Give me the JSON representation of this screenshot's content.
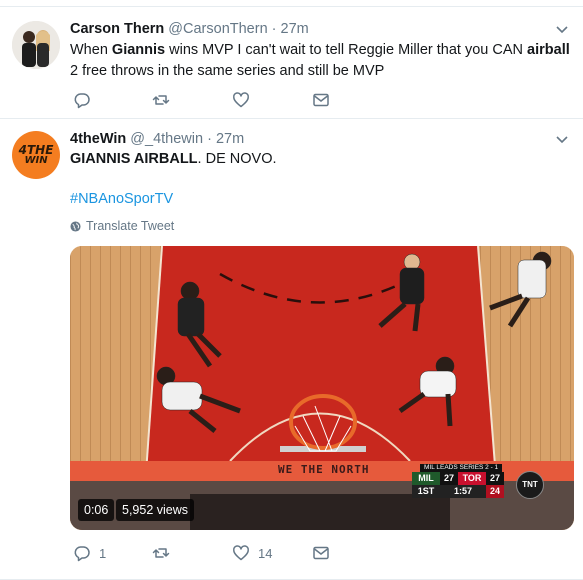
{
  "tweets": [
    {
      "name": "Carson Thern",
      "handle": "@CarsonThern",
      "separator": "·",
      "time": "27m",
      "text_parts": {
        "p1": "When ",
        "b1": "Giannis",
        "p2": " wins MVP I can't wait to tell Reggie Miller that you CAN ",
        "b2": "airball",
        "p3": " 2 free throws in the same series and still be MVP"
      },
      "actions": {
        "reply_count": "",
        "retweet_count": "",
        "like_count": ""
      }
    },
    {
      "name": "4theWin",
      "handle": "@_4thewin",
      "separator": "·",
      "time": "27m",
      "avatar_logo": {
        "line1": "4THE",
        "line2": "WIN"
      },
      "text_parts": {
        "b1": "GIANNIS AIRBALL",
        "p1": ". DE NOVO."
      },
      "hashtag": "#NBAnoSporTV",
      "translate_label": "Translate Tweet",
      "video": {
        "duration": "0:06",
        "views": "5,952 views",
        "court_text": "WE THE NORTH",
        "scorebug": {
          "header": "MIL LEADS SERIES 2 - 1",
          "team_away": "MIL",
          "score_away": "27",
          "team_home": "TOR",
          "score_home": "27",
          "quarter": "1ST",
          "clock": "1:57",
          "shot_clock": "24",
          "network": "TNT"
        }
      },
      "actions": {
        "reply_count": "1",
        "retweet_count": "",
        "like_count": "14"
      }
    }
  ],
  "colors": {
    "link": "#1b95e0",
    "muted": "#657786",
    "text": "#14171a",
    "court_paint": "#c8281e"
  },
  "icons": [
    "chevron-down-icon",
    "reply-icon",
    "retweet-icon",
    "like-icon",
    "direct-message-icon",
    "globe-icon"
  ]
}
